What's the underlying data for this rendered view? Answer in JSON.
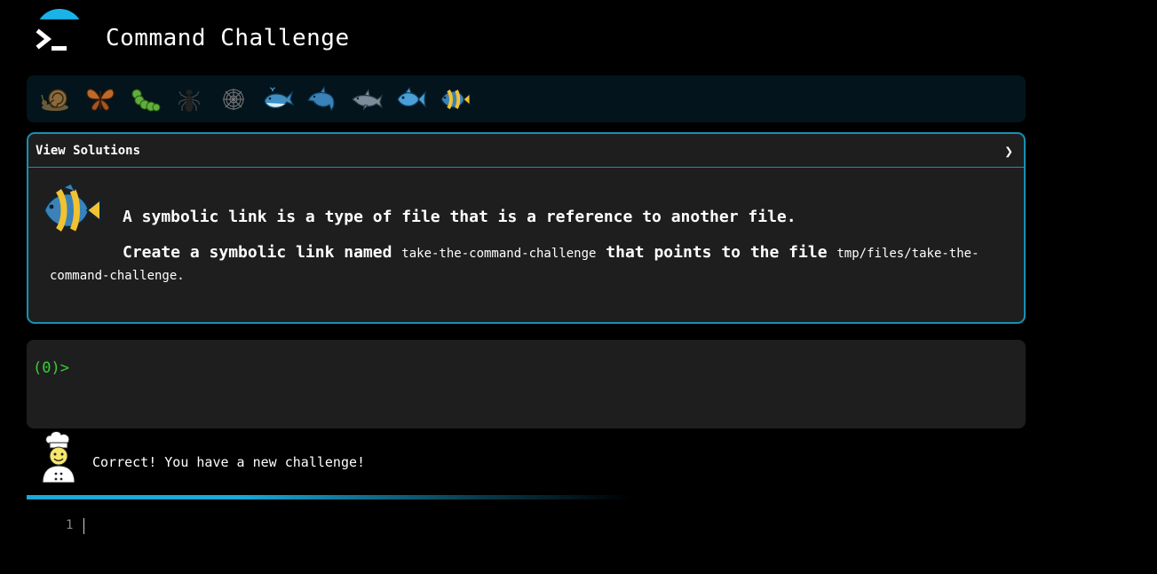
{
  "app": {
    "title": "Command Challenge",
    "logo_icon": "terminal-prompt-icon",
    "accent_color": "#1ab3e8"
  },
  "levels": [
    {
      "icon": "snail-icon"
    },
    {
      "icon": "butterfly-icon"
    },
    {
      "icon": "caterpillar-icon"
    },
    {
      "icon": "ant-icon"
    },
    {
      "icon": "spider-web-icon"
    },
    {
      "icon": "whale-icon"
    },
    {
      "icon": "dolphin-icon"
    },
    {
      "icon": "dolphin-gray-icon"
    },
    {
      "icon": "fish-icon"
    },
    {
      "icon": "tropical-fish-icon"
    }
  ],
  "challenge": {
    "solutions_label": "View Solutions",
    "chevron": "❯",
    "icon": "tropical-fish-icon",
    "line1": "A symbolic link is a type of file that is a reference to another file.",
    "line2_part1": "Create a symbolic link named",
    "line2_code1": "take-the-command-challenge",
    "line2_part2": "that points to the file",
    "line2_code2": "tmp/files/take-the-command-challenge",
    "line2_end": "."
  },
  "terminal": {
    "prompt": "(0)>",
    "prompt_color": "#3acd3a"
  },
  "feedback": {
    "icon": "chef-icon",
    "message": "Correct! You have a new challenge!"
  },
  "editor": {
    "line_number": "1"
  }
}
